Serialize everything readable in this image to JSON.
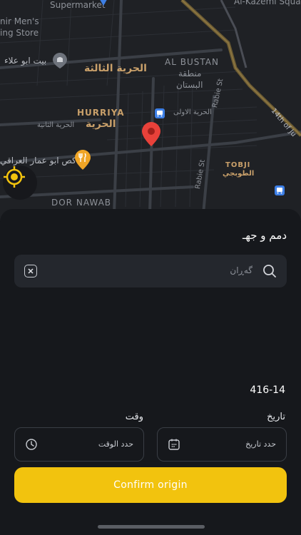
{
  "map": {
    "labels": {
      "supermarket": "Supermarket",
      "mens_store_1": "nir Men's",
      "mens_store_2": "ing Store",
      "kazemi": "Al-Kazemi Squa",
      "abu_alaa": "بيت ابو علاء",
      "hurriya_third": "الحرية الثالثة",
      "al_bustan": "AL BUSTAN",
      "bustan_ar_1": "منطقة",
      "bustan_ar_2": "البستان",
      "hurriya_first": "الحرية الاولى",
      "hurriya_en": "HURRIYA",
      "hurriya_ar": "الحرية",
      "hurriya_second": "الحرية الثانية",
      "abu_ammar": "كص ابو عمار العراقي",
      "rabie_st_1": "Rabie St",
      "rabie_st_2": "Rabie St",
      "fourteenth": "14th of Ju",
      "tobji_en": "TOBJI",
      "tobji_ar": "الطوبجي",
      "dor_nawab": "DOR NAWAB"
    },
    "colors": {
      "pin": "#e8413a",
      "restaurant": "#f0a526",
      "bus": "#3d7fe6",
      "highway": "#6a5a33"
    },
    "icons": {
      "pin": "map-pin-icon",
      "restaurant": "fork-knife-icon",
      "bus": "bus-stop-icon",
      "location": "crosshair-location-icon"
    }
  },
  "sheet": {
    "title": "دمم و جهـ",
    "search": {
      "placeholder": "گەڕان",
      "clear_icon": "clear-icon",
      "search_icon": "search-icon"
    },
    "plate": "416-14",
    "date": {
      "label": "تاريخ",
      "placeholder": "حدد تاريخ",
      "icon": "calendar-icon"
    },
    "time": {
      "label": "وقت",
      "placeholder": "حدد الوقت",
      "icon": "clock-icon"
    },
    "confirm_label": "Confirm origin",
    "accent": "#f2c30e"
  }
}
